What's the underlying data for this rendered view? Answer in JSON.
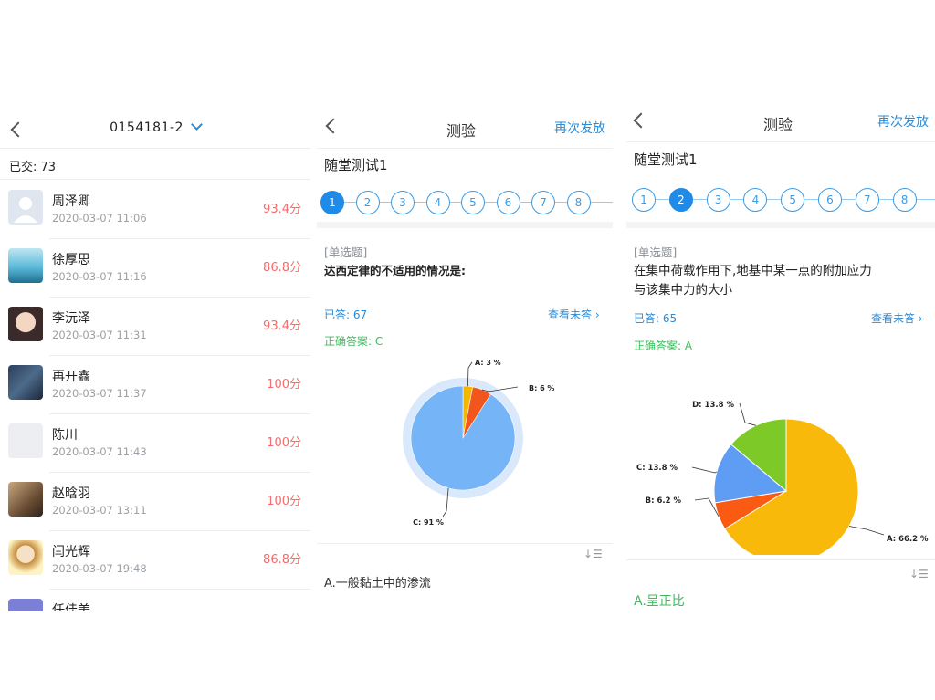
{
  "left": {
    "title": "0154181-2",
    "submitted_label": "已交: 73",
    "students": [
      {
        "name": "周泽卿",
        "time": "2020-03-07 11:06",
        "score": "93.4分",
        "avatar": "default"
      },
      {
        "name": "徐厚思",
        "time": "2020-03-07 11:16",
        "score": "86.8分",
        "avatar": "ocean"
      },
      {
        "name": "李沅泽",
        "time": "2020-03-07 11:31",
        "score": "93.4分",
        "avatar": "anime"
      },
      {
        "name": "再开鑫",
        "time": "2020-03-07 11:37",
        "score": "100分",
        "avatar": "dark"
      },
      {
        "name": "陈川",
        "time": "2020-03-07 11:43",
        "score": "100分",
        "avatar": "blank"
      },
      {
        "name": "赵晗羽",
        "time": "2020-03-07 13:11",
        "score": "100分",
        "avatar": "sepia"
      },
      {
        "name": "闫光辉",
        "time": "2020-03-07 19:48",
        "score": "86.8分",
        "avatar": "cartoon"
      },
      {
        "name": "任佳美",
        "time": "",
        "score": "",
        "avatar": "purple"
      }
    ]
  },
  "quiz1": {
    "title": "测验",
    "resend": "再次发放",
    "quiz_name": "随堂测试1",
    "steps": [
      "1",
      "2",
      "3",
      "4",
      "5",
      "6",
      "7",
      "8"
    ],
    "active_step": 0,
    "question_type": "[单选题]",
    "question": "达西定律的不适用的情况是:",
    "answered": "已答: 67",
    "view_unanswered": "查看未答",
    "correct_answer": "正确答案: C",
    "first_option": "A.一般黏土中的渗流"
  },
  "quiz2": {
    "title": "测验",
    "resend": "再次发放",
    "quiz_name": "随堂测试1",
    "steps": [
      "1",
      "2",
      "3",
      "4",
      "5",
      "6",
      "7",
      "8"
    ],
    "active_step": 1,
    "question_type": "[单选题]",
    "question_line1": "在集中荷载作用下,地基中某一点的附加应力",
    "question_line2": "与该集中力的大小",
    "answered": "已答: 65",
    "view_unanswered": "查看未答",
    "correct_answer": "正确答案: A",
    "first_option": "A.呈正比"
  },
  "chart_data": [
    {
      "type": "pie",
      "categories": [
        "A",
        "B",
        "C"
      ],
      "values": [
        3,
        6,
        91
      ],
      "labels": [
        "A: 3 %",
        "B: 6 %",
        "C: 91 %"
      ],
      "colors": [
        "#f5b800",
        "#f2561d",
        "#74b4f7"
      ]
    },
    {
      "type": "pie",
      "categories": [
        "A",
        "B",
        "C",
        "D"
      ],
      "values": [
        66.2,
        6.2,
        13.8,
        13.8
      ],
      "labels": [
        "A: 66.2 %",
        "B: 6.2 %",
        "C: 13.8 %",
        "D: 13.8 %"
      ],
      "colors": [
        "#f9b90a",
        "#fa5a12",
        "#5f9df5",
        "#7cc928"
      ]
    }
  ]
}
